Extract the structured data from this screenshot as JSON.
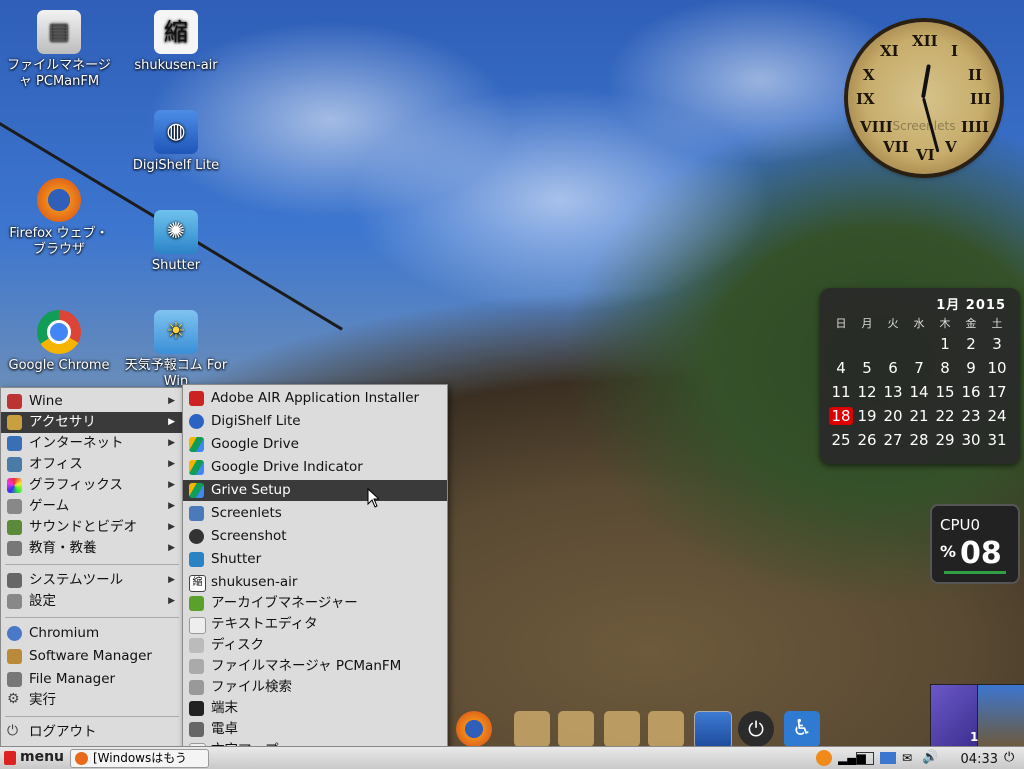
{
  "desktop_icons": [
    {
      "label": "ファイルマネージャ PCManFM",
      "icon": "file-manager-icon"
    },
    {
      "label": "shukusen-air",
      "icon": "shukusen-icon"
    },
    {
      "label": "DigiShelf Lite",
      "icon": "digishelf-icon"
    },
    {
      "label": "Firefox ウェブ・ブラウザ",
      "icon": "firefox-icon"
    },
    {
      "label": "Shutter",
      "icon": "shutter-icon"
    },
    {
      "label": "Google Chrome",
      "icon": "chrome-icon"
    },
    {
      "label": "天気予報コム For Win",
      "icon": "weather-icon"
    }
  ],
  "clock": {
    "label": "Screenlets",
    "numerals": [
      "XII",
      "I",
      "II",
      "III",
      "IIII",
      "V",
      "VI",
      "VII",
      "VIII",
      "IX",
      "X",
      "XI"
    ]
  },
  "calendar": {
    "header": "1月 2015",
    "weekdays": [
      "日",
      "月",
      "火",
      "水",
      "木",
      "金",
      "土"
    ],
    "weeks": [
      [
        "",
        "",
        "",
        "",
        "1",
        "2",
        "3"
      ],
      [
        "4",
        "5",
        "6",
        "7",
        "8",
        "9",
        "10"
      ],
      [
        "11",
        "12",
        "13",
        "14",
        "15",
        "16",
        "17"
      ],
      [
        "18",
        "19",
        "20",
        "21",
        "22",
        "23",
        "24"
      ],
      [
        "25",
        "26",
        "27",
        "28",
        "29",
        "30",
        "31"
      ]
    ],
    "today": "18"
  },
  "cpu": {
    "title": "CPU0",
    "unit": "%",
    "value": "08"
  },
  "main_menu": {
    "items": [
      {
        "label": "Wine",
        "submenu": true,
        "color": "#b33"
      },
      {
        "label": "アクセサリ",
        "submenu": true,
        "selected": true,
        "color": "#c8a040"
      },
      {
        "label": "インターネット",
        "submenu": true,
        "color": "#3b6fb5"
      },
      {
        "label": "オフィス",
        "submenu": true,
        "color": "#4a7aa8"
      },
      {
        "label": "グラフィックス",
        "submenu": true,
        "color": "#c73f9b"
      },
      {
        "label": "ゲーム",
        "submenu": true,
        "color": "#888"
      },
      {
        "label": "サウンドとビデオ",
        "submenu": true,
        "color": "#5a8a3a"
      },
      {
        "label": "教育・教養",
        "submenu": true,
        "color": "#777"
      }
    ],
    "items2": [
      {
        "label": "システムツール",
        "submenu": true,
        "color": "#666"
      },
      {
        "label": "設定",
        "submenu": true,
        "color": "#888"
      }
    ],
    "items3": [
      {
        "label": "Chromium",
        "color": "#4a79c8"
      },
      {
        "label": "Software Manager",
        "color": "#b98a3a"
      },
      {
        "label": "File Manager",
        "color": "#777"
      },
      {
        "label": "実行",
        "color": "#555"
      }
    ],
    "logout": "ログアウト"
  },
  "sub_menu": {
    "items": [
      {
        "label": "Adobe AIR Application Installer",
        "color": "#c22"
      },
      {
        "label": "DigiShelf Lite",
        "color": "#2a63c2"
      },
      {
        "label": "Google Drive",
        "color": "#2d9b4a"
      },
      {
        "label": "Google Drive Indicator",
        "color": "#2d9b4a"
      },
      {
        "label": "Grive Setup",
        "selected": true,
        "color": "#2d9b4a"
      },
      {
        "label": "Screenlets",
        "color": "#4a7ab8"
      },
      {
        "label": "Screenshot",
        "color": "#333"
      },
      {
        "label": "Shutter",
        "color": "#2a83c2"
      },
      {
        "label": "shukusen-air",
        "color": "#444"
      },
      {
        "label": "アーカイブマネージャー",
        "color": "#5aa02c"
      },
      {
        "label": "テキストエディタ",
        "color": "#ccc"
      },
      {
        "label": "ディスク",
        "color": "#bbb"
      },
      {
        "label": "ファイルマネージャ PCManFM",
        "color": "#aaa"
      },
      {
        "label": "ファイル検索",
        "color": "#999"
      },
      {
        "label": "端末",
        "color": "#222"
      },
      {
        "label": "電卓",
        "color": "#666"
      },
      {
        "label": "文字マップ",
        "color": "#eee"
      }
    ]
  },
  "taskbar": {
    "menu_label": "menu",
    "window_label": "[Windowsはもう",
    "time": "04:33"
  },
  "pager": {
    "workspace": "1"
  }
}
